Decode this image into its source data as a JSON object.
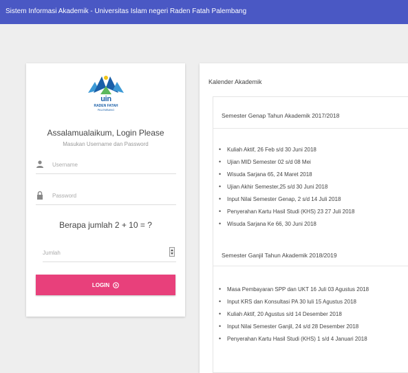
{
  "header": {
    "title": "Sistem Informasi Akademik - Universitas Islam negeri Raden Fatah Palembang"
  },
  "colors": {
    "header_bg": "#4a58c4",
    "login_button": "#e8407b"
  },
  "login": {
    "logo": {
      "word": "uin",
      "line1": "RADEN FATAH",
      "line2": "PALEMBANG"
    },
    "title": "Assalamualaikum, Login Please",
    "subtitle": "Masukan Username dan Password",
    "username_placeholder": "Username",
    "username_value": "",
    "password_placeholder": "Password",
    "password_value": "",
    "captcha_question": "Berapa jumlah 2 + 10 = ?",
    "answer_placeholder": "Jumlah",
    "answer_value": "",
    "button_label": "LOGIN",
    "icons": {
      "user": "user-icon",
      "lock": "lock-icon",
      "button": "arrow-circle-right-icon"
    }
  },
  "calendar": {
    "title": "Kalender Akademik",
    "semesters": [
      {
        "heading": "Semester Genap Tahun Akademik 2017/2018",
        "items": [
          "Kuliah Aktif, 26 Feb s/d 30 Juni 2018",
          "Ujian MID Semester 02 s/d 08 Mei",
          "Wisuda Sarjana 65, 24 Maret 2018",
          "Ujian Akhir Semester,25 s/d 30 Juni 2018",
          "Input Nilai Semester Genap, 2 s/d 14 Juli 2018",
          "Penyerahan Kartu Hasil Studi (KHS) 23 27 Juli 2018",
          "Wisuda Sarjana Ke 66, 30 Juni 2018"
        ]
      },
      {
        "heading": "Semester Ganjil Tahun Akademik 2018/2019",
        "items": [
          "Masa Pembayaran SPP dan UKT 16 Juli 03 Agustus 2018",
          "Input KRS dan Konsultasi PA 30 luli 15 Agustus 2018",
          "Kuliah Aktif, 20 Agustus s/d 14 Desember 2018",
          "Input Nilai Semester Ganjil, 24 s/d 28 Desember 2018",
          "Penyerahan Kartu Hasil Studi (KHS) 1 s/d 4 Januari 2018"
        ]
      }
    ]
  }
}
